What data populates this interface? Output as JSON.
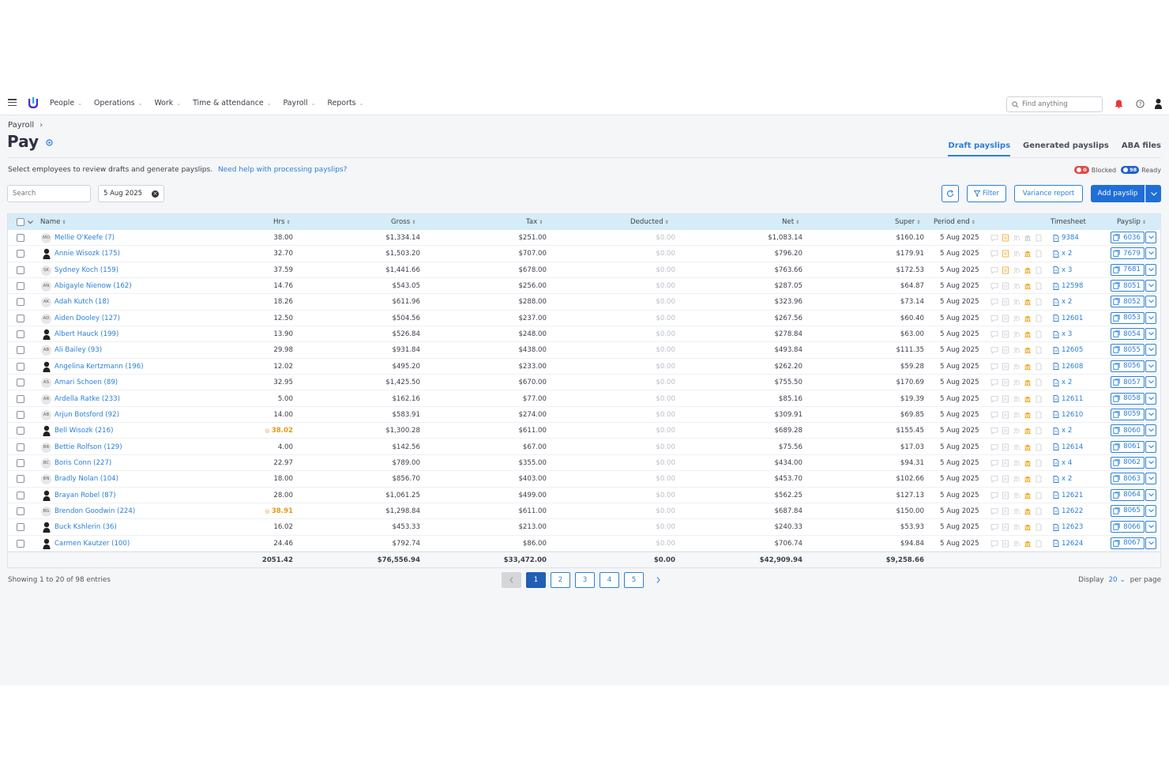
{
  "nav": {
    "items": [
      {
        "label": "People"
      },
      {
        "label": "Operations"
      },
      {
        "label": "Work"
      },
      {
        "label": "Time & attendance"
      },
      {
        "label": "Payroll"
      },
      {
        "label": "Reports"
      }
    ],
    "search_placeholder": "Find anything"
  },
  "header": {
    "breadcrumb": "Payroll",
    "title": "Pay",
    "tabs": [
      {
        "label": "Draft payslips",
        "active": true
      },
      {
        "label": "Generated payslips",
        "active": false
      },
      {
        "label": "ABA files",
        "active": false
      }
    ],
    "intro": "Select employees to review drafts and generate payslips.",
    "help_link": "Need help with processing payslips?",
    "blocked_count": "0",
    "blocked_label": "Blocked",
    "ready_count": "98",
    "ready_label": "Ready"
  },
  "toolbar": {
    "search_placeholder": "Search",
    "date": "5 Aug 2025",
    "filter_label": "Filter",
    "variance_label": "Variance report",
    "add_label": "Add payslip"
  },
  "table": {
    "columns": {
      "name": "Name",
      "hrs": "Hrs",
      "gross": "Gross",
      "tax": "Tax",
      "deducted": "Deducted",
      "net": "Net",
      "super": "Super",
      "period_end": "Period end",
      "timesheet": "Timesheet",
      "payslip": "Payslip"
    },
    "rows": [
      {
        "initials": "MO",
        "name": "Mellie O'Keefe (7)",
        "hrs": "38.00",
        "warn": false,
        "gross": "$1,334.14",
        "tax": "$251.00",
        "deducted": "$0.00",
        "net": "$1,083.14",
        "super": "$160.10",
        "period": "5 Aug 2025",
        "timesheet": "9384",
        "payslip": "6036"
      },
      {
        "initials": "",
        "name": "Annie Wisozk (175)",
        "hrs": "32.70",
        "warn": false,
        "gross": "$1,503.20",
        "tax": "$707.00",
        "deducted": "$0.00",
        "net": "$796.20",
        "super": "$179.91",
        "period": "5 Aug 2025",
        "timesheet": "x 2",
        "payslip": "7679"
      },
      {
        "initials": "SK",
        "name": "Sydney Koch (159)",
        "hrs": "37.59",
        "warn": false,
        "gross": "$1,441.66",
        "tax": "$678.00",
        "deducted": "$0.00",
        "net": "$763.66",
        "super": "$172.53",
        "period": "5 Aug 2025",
        "timesheet": "x 3",
        "payslip": "7681"
      },
      {
        "initials": "AN",
        "name": "Abigayle Nienow (162)",
        "hrs": "14.76",
        "warn": false,
        "gross": "$543.05",
        "tax": "$256.00",
        "deducted": "$0.00",
        "net": "$287.05",
        "super": "$64.87",
        "period": "5 Aug 2025",
        "timesheet": "12598",
        "payslip": "8051"
      },
      {
        "initials": "AK",
        "name": "Adah Kutch (18)",
        "hrs": "18.26",
        "warn": false,
        "gross": "$611.96",
        "tax": "$288.00",
        "deducted": "$0.00",
        "net": "$323.96",
        "super": "$73.14",
        "period": "5 Aug 2025",
        "timesheet": "x 2",
        "payslip": "8052"
      },
      {
        "initials": "AD",
        "name": "Aiden Dooley (127)",
        "hrs": "12.50",
        "warn": false,
        "gross": "$504.56",
        "tax": "$237.00",
        "deducted": "$0.00",
        "net": "$267.56",
        "super": "$60.40",
        "period": "5 Aug 2025",
        "timesheet": "12601",
        "payslip": "8053"
      },
      {
        "initials": "",
        "name": "Albert Hauck (199)",
        "hrs": "13.90",
        "warn": false,
        "gross": "$526.84",
        "tax": "$248.00",
        "deducted": "$0.00",
        "net": "$278.84",
        "super": "$63.00",
        "period": "5 Aug 2025",
        "timesheet": "x 3",
        "payslip": "8054"
      },
      {
        "initials": "AB",
        "name": "Ali Bailey (93)",
        "hrs": "29.98",
        "warn": false,
        "gross": "$931.84",
        "tax": "$438.00",
        "deducted": "$0.00",
        "net": "$493.84",
        "super": "$111.35",
        "period": "5 Aug 2025",
        "timesheet": "12605",
        "payslip": "8055"
      },
      {
        "initials": "",
        "name": "Angelina Kertzmann (196)",
        "hrs": "12.02",
        "warn": false,
        "gross": "$495.20",
        "tax": "$233.00",
        "deducted": "$0.00",
        "net": "$262.20",
        "super": "$59.28",
        "period": "5 Aug 2025",
        "timesheet": "12608",
        "payslip": "8056"
      },
      {
        "initials": "AS",
        "name": "Amari Schoen (89)",
        "hrs": "32.95",
        "warn": false,
        "gross": "$1,425.50",
        "tax": "$670.00",
        "deducted": "$0.00",
        "net": "$755.50",
        "super": "$170.69",
        "period": "5 Aug 2025",
        "timesheet": "x 2",
        "payslip": "8057"
      },
      {
        "initials": "AR",
        "name": "Ardella Ratke (233)",
        "hrs": "5.00",
        "warn": false,
        "gross": "$162.16",
        "tax": "$77.00",
        "deducted": "$0.00",
        "net": "$85.16",
        "super": "$19.39",
        "period": "5 Aug 2025",
        "timesheet": "12611",
        "payslip": "8058"
      },
      {
        "initials": "AB",
        "name": "Arjun Botsford (92)",
        "hrs": "14.00",
        "warn": false,
        "gross": "$583.91",
        "tax": "$274.00",
        "deducted": "$0.00",
        "net": "$309.91",
        "super": "$69.85",
        "period": "5 Aug 2025",
        "timesheet": "12610",
        "payslip": "8059"
      },
      {
        "initials": "",
        "name": "Bell Wisozk (216)",
        "hrs": "38.02",
        "warn": true,
        "gross": "$1,300.28",
        "tax": "$611.00",
        "deducted": "$0.00",
        "net": "$689.28",
        "super": "$155.45",
        "period": "5 Aug 2025",
        "timesheet": "x 2",
        "payslip": "8060"
      },
      {
        "initials": "BR",
        "name": "Bettie Rolfson (129)",
        "hrs": "4.00",
        "warn": false,
        "gross": "$142.56",
        "tax": "$67.00",
        "deducted": "$0.00",
        "net": "$75.56",
        "super": "$17.03",
        "period": "5 Aug 2025",
        "timesheet": "12614",
        "payslip": "8061"
      },
      {
        "initials": "BC",
        "name": "Boris Conn (227)",
        "hrs": "22.97",
        "warn": false,
        "gross": "$789.00",
        "tax": "$355.00",
        "deducted": "$0.00",
        "net": "$434.00",
        "super": "$94.31",
        "period": "5 Aug 2025",
        "timesheet": "x 4",
        "payslip": "8062"
      },
      {
        "initials": "BN",
        "name": "Bradly Nolan (104)",
        "hrs": "18.00",
        "warn": false,
        "gross": "$856.70",
        "tax": "$403.00",
        "deducted": "$0.00",
        "net": "$453.70",
        "super": "$102.66",
        "period": "5 Aug 2025",
        "timesheet": "x 2",
        "payslip": "8063"
      },
      {
        "initials": "",
        "name": "Brayan Robel (87)",
        "hrs": "28.00",
        "warn": false,
        "gross": "$1,061.25",
        "tax": "$499.00",
        "deducted": "$0.00",
        "net": "$562.25",
        "super": "$127.13",
        "period": "5 Aug 2025",
        "timesheet": "12621",
        "payslip": "8064"
      },
      {
        "initials": "BG",
        "name": "Brendon Goodwin (224)",
        "hrs": "38.91",
        "warn": true,
        "gross": "$1,298.84",
        "tax": "$611.00",
        "deducted": "$0.00",
        "net": "$687.84",
        "super": "$150.00",
        "period": "5 Aug 2025",
        "timesheet": "12622",
        "payslip": "8065"
      },
      {
        "initials": "",
        "name": "Buck Kshlerin (36)",
        "hrs": "16.02",
        "warn": false,
        "gross": "$453.33",
        "tax": "$213.00",
        "deducted": "$0.00",
        "net": "$240.33",
        "super": "$53.93",
        "period": "5 Aug 2025",
        "timesheet": "12623",
        "payslip": "8066"
      },
      {
        "initials": "",
        "name": "Carmen Kautzer (100)",
        "hrs": "24.46",
        "warn": false,
        "gross": "$792.74",
        "tax": "$86.00",
        "deducted": "$0.00",
        "net": "$706.74",
        "super": "$94.84",
        "period": "5 Aug 2025",
        "timesheet": "12624",
        "payslip": "8067"
      }
    ],
    "totals": {
      "hrs": "2051.42",
      "gross": "$76,556.94",
      "tax": "$33,472.00",
      "deducted": "$0.00",
      "net": "$42,909.94",
      "super": "$9,258.66"
    }
  },
  "footer": {
    "showing": "Showing 1 to 20 of 98 entries",
    "pages": [
      "1",
      "2",
      "3",
      "4",
      "5"
    ],
    "display_label": "Display",
    "display_value": "20",
    "per_page_label": "per page"
  },
  "colors": {
    "accent": "#2b7fd6",
    "warning": "#e89a15",
    "header_bg": "#d6ecf8"
  }
}
